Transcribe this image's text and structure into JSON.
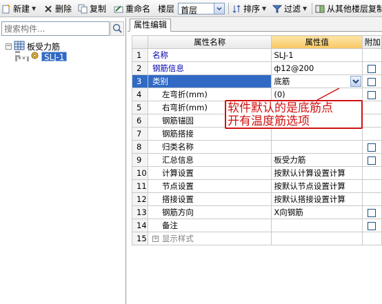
{
  "toolbar": {
    "new_label": "新建",
    "delete_label": "删除",
    "copy_label": "复制",
    "rename_label": "重命名",
    "floor_label": "楼层",
    "floor_value": "首层",
    "sort_label": "排序",
    "filter_label": "过滤",
    "copy_from_floor_label": "从其他楼层复制"
  },
  "sidebar": {
    "search_placeholder": "搜索构件...",
    "tree": {
      "root_label": "板受力筋",
      "children": [
        "SLJ-1"
      ]
    }
  },
  "tabs": [
    {
      "label": "属性编辑"
    }
  ],
  "grid": {
    "headers": {
      "name": "属性名称",
      "value": "属性值",
      "extra": "附加"
    },
    "rows": [
      {
        "num": "1",
        "name": "名称",
        "value": "SLJ-1"
      },
      {
        "num": "2",
        "name": "钢筋信息",
        "value": "ф12@200"
      },
      {
        "num": "3",
        "name": "类别",
        "value": "底筋"
      },
      {
        "num": "4",
        "name": "左弯折(mm)",
        "value": "(0)"
      },
      {
        "num": "5",
        "name": "右弯折(mm)",
        "value": ""
      },
      {
        "num": "6",
        "name": "钢筋锚固",
        "value": ""
      },
      {
        "num": "7",
        "name": "钢筋搭接",
        "value": ""
      },
      {
        "num": "8",
        "name": "归类名称",
        "value": ""
      },
      {
        "num": "9",
        "name": "汇总信息",
        "value": "板受力筋"
      },
      {
        "num": "10",
        "name": "计算设置",
        "value": "按默认计算设置计算"
      },
      {
        "num": "11",
        "name": "节点设置",
        "value": "按默认节点设置计算"
      },
      {
        "num": "12",
        "name": "搭接设置",
        "value": "按默认搭接设置计算"
      },
      {
        "num": "13",
        "name": "钢筋方向",
        "value": "X向钢筋"
      },
      {
        "num": "14",
        "name": "备注",
        "value": ""
      },
      {
        "num": "15",
        "name": "显示样式",
        "value": ""
      }
    ]
  },
  "annotation": {
    "line1": "软件默认的是底筋点",
    "line2": "开有温度筋选项"
  },
  "colors": {
    "selection": "#316ac5",
    "annotation": "#d01010",
    "value_header": "#f8c763",
    "name_text": "#0000b0"
  }
}
